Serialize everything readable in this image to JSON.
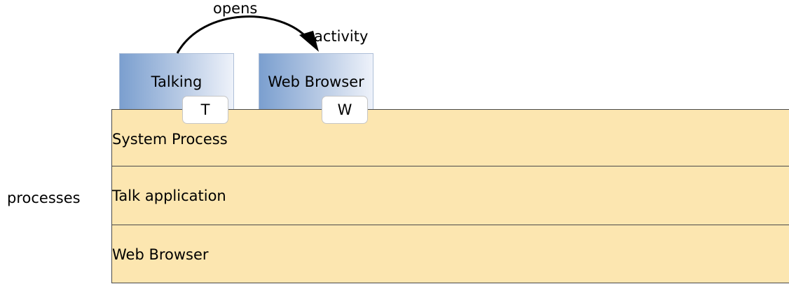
{
  "activities": [
    {
      "title": "Talking",
      "tab": "T"
    },
    {
      "title": "Web Browser",
      "tab": "W"
    }
  ],
  "arrow": {
    "opens_label": "opens",
    "activity_label": "activity"
  },
  "processes": {
    "side_label": "processes",
    "rows": [
      "System Process",
      "Talk application",
      "Web Browser"
    ]
  },
  "colors": {
    "process_fill": "#fce6b0",
    "activity_gradient_start": "#7b9fcf",
    "activity_gradient_end": "#eef2fa"
  }
}
